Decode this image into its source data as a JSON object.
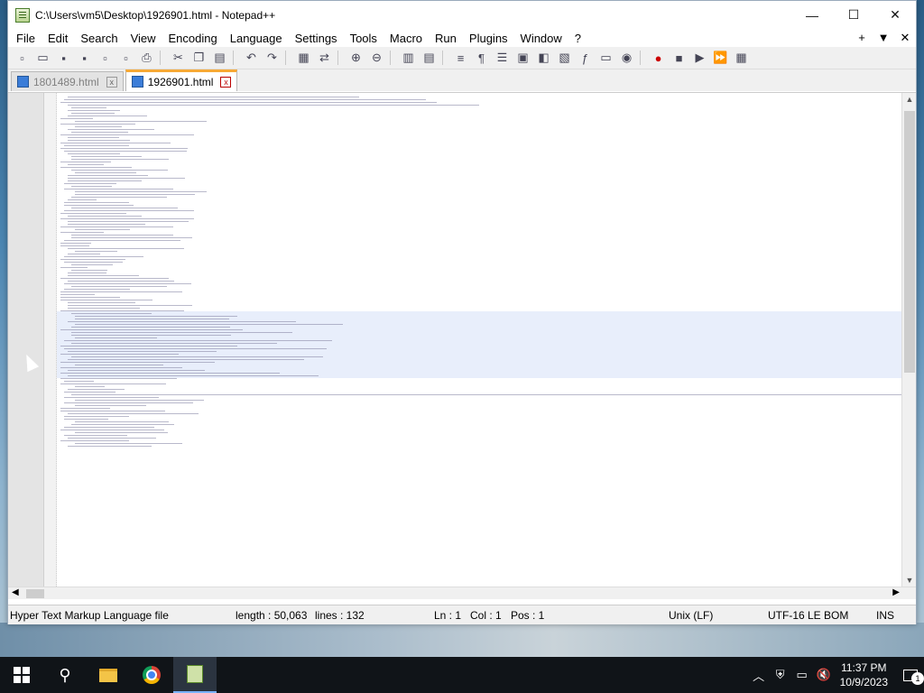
{
  "window": {
    "title": "C:\\Users\\vm5\\Desktop\\1926901.html - Notepad++",
    "minimize": "—",
    "maximize": "☐",
    "close": "✕"
  },
  "menu": [
    "File",
    "Edit",
    "Search",
    "View",
    "Encoding",
    "Language",
    "Settings",
    "Tools",
    "Macro",
    "Run",
    "Plugins",
    "Window",
    "?"
  ],
  "menu_right": {
    "plus": "+",
    "dropdown": "▼",
    "close": "✕"
  },
  "tabs": [
    {
      "label": "1801489.html",
      "close": "x"
    },
    {
      "label": "1926901.html",
      "close": "x"
    }
  ],
  "status": {
    "filetype": "Hyper Text Markup Language file",
    "length": "length : 50,063",
    "lines": "lines : 132",
    "ln": "Ln : 1",
    "col": "Col : 1",
    "pos": "Pos : 1",
    "eol": "Unix (LF)",
    "encoding": "UTF-16 LE BOM",
    "mode": "INS"
  },
  "taskbar": {
    "time": "11:37 PM",
    "date": "10/9/2023",
    "notification_count": "1"
  }
}
